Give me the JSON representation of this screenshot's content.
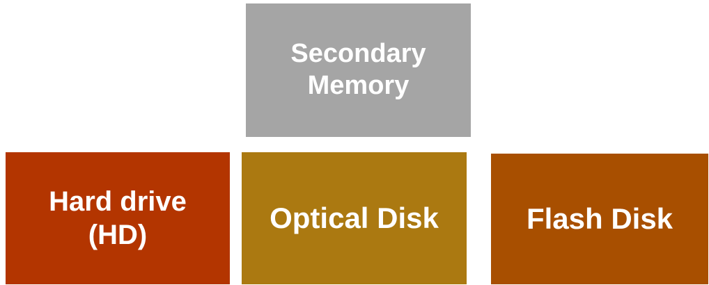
{
  "diagram": {
    "root": {
      "label": "Secondary\nMemory",
      "color": "#a5a5a5"
    },
    "children": [
      {
        "label": "Hard drive\n(HD)",
        "color": "#b33500"
      },
      {
        "label": "Optical Disk",
        "color": "#ab7911"
      },
      {
        "label": "Flash Disk",
        "color": "#a84f00"
      }
    ]
  }
}
